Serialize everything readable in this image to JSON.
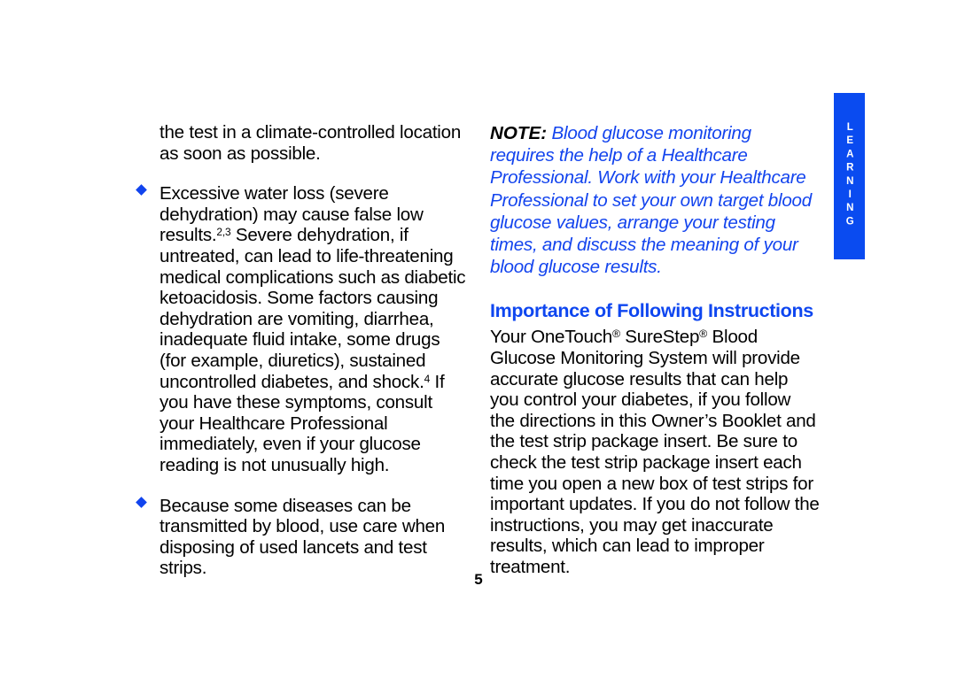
{
  "page": {
    "folio": "5",
    "background_color": "#ffffff",
    "accent_blue": "#0A4BF0",
    "heading_blue": "#0E46F0",
    "note_blue": "#1344EE",
    "bullet_blue": "#1144EE"
  },
  "side_tab": {
    "label": "LEARNING",
    "letters": "L E A R N I N G",
    "background_color": "#0A4BF0",
    "text_color": "#ffffff"
  },
  "left_column": {
    "continuation_paragraph": "the test in a climate-controlled location as soon as possible.",
    "bullets": [
      {
        "marker": "diamond-bullet",
        "text_before_footnote_1": "Excessive water loss (severe dehydration) may cause false low results.",
        "footnote_1": "2,3",
        "text_mid": " Severe dehydration, if untreated, can lead to life-threatening medical complications such as diabetic ketoacidosis. Some factors causing dehydration are vomiting, diarrhea, inadequate fluid intake, some drugs (for example, diuretics), sustained uncontrolled diabetes, and shock.",
        "footnote_2": "4",
        "text_after": " If you have these symptoms, consult your Healthcare Professional immediately, even if your glucose reading is not unusually high."
      },
      {
        "marker": "diamond-bullet",
        "text_before_footnote_1": "Because some diseases can be transmitted by blood, use care when disposing of used lancets and test strips.",
        "footnote_1": "",
        "text_mid": "",
        "footnote_2": "",
        "text_after": ""
      }
    ]
  },
  "right_column": {
    "note": {
      "label": "NOTE:",
      "text": " Blood glucose monitoring requires the help of a Healthcare Professional. Work with your Healthcare Professional to set your own target blood glucose values, arrange your testing times, and discuss the meaning of your blood glucose results."
    },
    "heading": "Importance of Following Instructions",
    "body": {
      "part_1": "Your OneTouch",
      "trademark_1": "®",
      "part_2": " SureStep",
      "trademark_2": "®",
      "part_3": " Blood Glucose Monitoring System will provide accurate glucose results that can help you control your diabetes, if you follow the directions in this Owner’s Booklet and the test strip package insert. Be sure to check the test strip package insert each time you open a new box of test strips for important updates. If you do not follow the instructions, you may get inaccurate results, which can lead to improper treatment."
    }
  }
}
